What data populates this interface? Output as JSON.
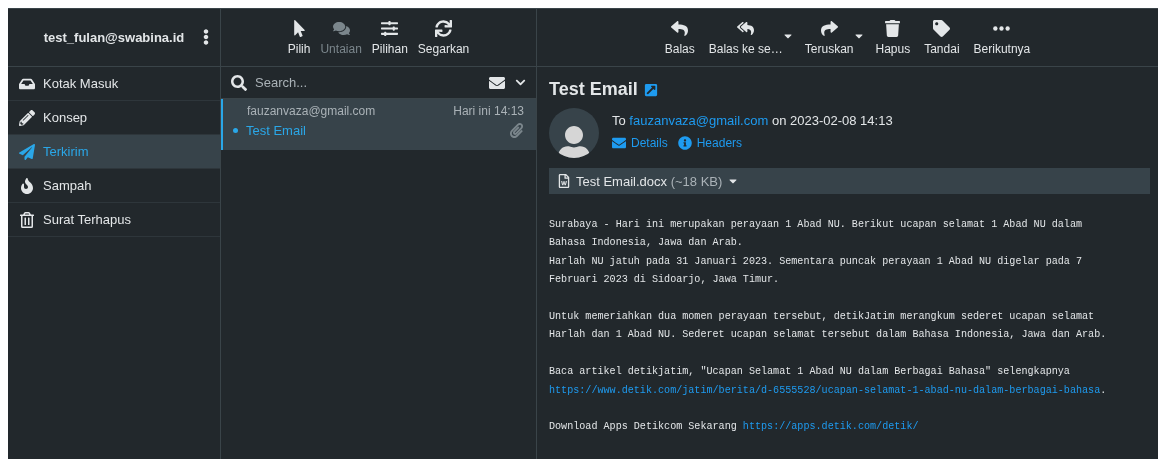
{
  "account": {
    "email": "test_fulan@swabina.id"
  },
  "folders": [
    {
      "label": "Kotak Masuk",
      "selected": false
    },
    {
      "label": "Konsep",
      "selected": false
    },
    {
      "label": "Terkirim",
      "selected": true
    },
    {
      "label": "Sampah",
      "selected": false
    },
    {
      "label": "Surat Terhapus",
      "selected": false
    }
  ],
  "list_toolbar": [
    {
      "label": "Pilih",
      "disabled": false
    },
    {
      "label": "Untaian",
      "disabled": true
    },
    {
      "label": "Pilihan",
      "disabled": false
    },
    {
      "label": "Segarkan",
      "disabled": false
    }
  ],
  "search": {
    "placeholder": "Search..."
  },
  "messages": [
    {
      "from": "fauzanvaza@gmail.com",
      "date": "Hari ini 14:13",
      "subject": "Test Email",
      "selected": true,
      "unread": true,
      "attachment": true
    }
  ],
  "message_toolbar": [
    {
      "label": "Balas",
      "menu": false
    },
    {
      "label": "Balas ke se…",
      "menu": true
    },
    {
      "label": "Teruskan",
      "menu": true
    },
    {
      "label": "Hapus",
      "menu": false
    },
    {
      "label": "Tandai",
      "menu": false
    },
    {
      "label": "Berikutnya",
      "menu": false
    }
  ],
  "email": {
    "subject": "Test Email",
    "to_prefix": "To",
    "to": "fauzanvaza@gmail.com",
    "date_text": "on 2023-02-08 14:13",
    "details": "Details",
    "headers": "Headers",
    "attachment": {
      "name": "Test Email.docx",
      "size": "(~18 KB)"
    },
    "body": [
      [
        {
          "text": "Surabaya - Hari ini merupakan perayaan 1 Abad NU. Berikut ucapan selamat 1 Abad NU dalam"
        },
        {
          "text": "Bahasa Indonesia, Jawa dan Arab."
        },
        {
          "text": "Harlah NU jatuh pada 31 Januari 2023. Sementara puncak perayaan 1 Abad NU digelar pada 7"
        },
        {
          "text": "Februari 2023 di Sidoarjo, Jawa Timur."
        }
      ],
      [
        {
          "text": "Untuk memeriahkan dua momen perayaan tersebut, detikJatim merangkum sederet ucapan selamat"
        },
        {
          "text": "Harlah dan 1 Abad NU. Sederet ucapan selamat tersebut dalam Bahasa Indonesia, Jawa dan Arab."
        }
      ],
      [
        {
          "text": "Baca artikel detikjatim, \"Ucapan Selamat 1 Abad NU dalam Berbagai Bahasa\" selengkapnya"
        },
        {
          "link": "https://www.detik.com/jatim/berita/d-6555528/ucapan-selamat-1-abad-nu-dalam-berbagai-bahasa",
          "after": "."
        }
      ],
      [
        {
          "text": "Download Apps Detikcom Sekarang",
          "link": "https://apps.detik.com/detik/"
        }
      ]
    ]
  }
}
